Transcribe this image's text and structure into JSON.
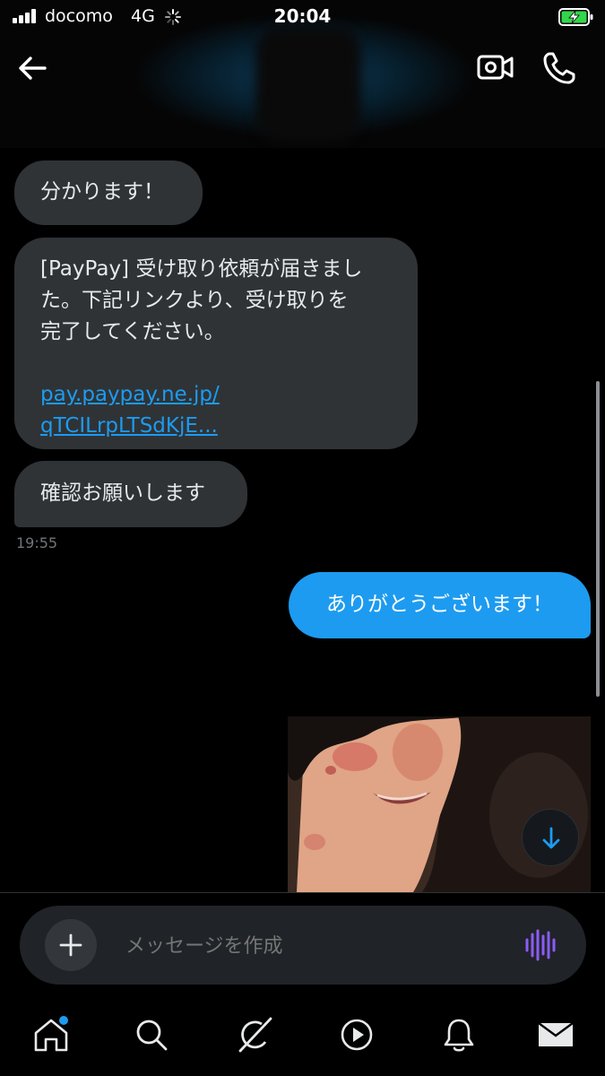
{
  "status_bar": {
    "carrier": "docomo",
    "network": "4G",
    "time": "20:04"
  },
  "header": {
    "back_icon": "arrow-left-icon",
    "video_icon": "video-camera-icon",
    "call_icon": "phone-icon"
  },
  "messages": [
    {
      "direction": "incoming",
      "text": "分かります！"
    },
    {
      "direction": "incoming",
      "lines": [
        "[PayPay] 受け取り依頼が届きまし",
        "た。下記リンクより、受け取りを",
        "完了してください。"
      ],
      "link_lines": [
        "pay.paypay.ne.jp/",
        "qTCILrpLTSdKjE..."
      ]
    },
    {
      "direction": "incoming",
      "text": "確認お願いします"
    }
  ],
  "timestamp": "19:55",
  "outgoing": {
    "text": "ありがとうございます！"
  },
  "composer": {
    "placeholder": "メッセージを作成",
    "add_icon": "plus-icon",
    "voice_icon": "voice-waveform-icon"
  },
  "nav": [
    "home-icon",
    "search-icon",
    "grok-icon",
    "play-icon",
    "bell-icon",
    "mail-icon"
  ],
  "colors": {
    "accent": "#1d9bf0",
    "bubble_incoming": "#2f3336",
    "background": "#000000",
    "voice": "#8b5cf6"
  }
}
